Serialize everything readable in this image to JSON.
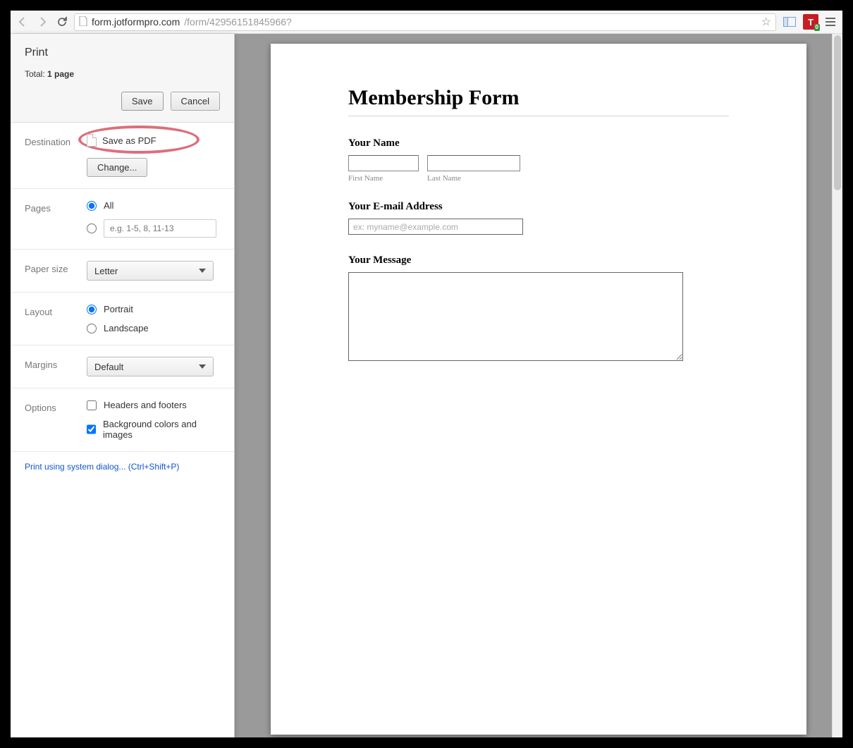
{
  "browser": {
    "url_host": "form.jotformpro.com",
    "url_path": "/form/42956151845966?",
    "ext_letter": "T",
    "ext_count": "0"
  },
  "print_panel": {
    "title": "Print",
    "total_prefix": "Total: ",
    "total_pages": "1 page",
    "save_btn": "Save",
    "cancel_btn": "Cancel",
    "destination_label": "Destination",
    "destination_value": "Save as PDF",
    "change_btn": "Change...",
    "pages_label": "Pages",
    "pages_all": "All",
    "pages_custom_placeholder": "e.g. 1-5, 8, 11-13",
    "paper_label": "Paper size",
    "paper_value": "Letter",
    "layout_label": "Layout",
    "layout_portrait": "Portrait",
    "layout_landscape": "Landscape",
    "margins_label": "Margins",
    "margins_value": "Default",
    "options_label": "Options",
    "opt_headers": "Headers and footers",
    "opt_bg": "Background colors and images",
    "system_link": "Print using system dialog... (Ctrl+Shift+P)"
  },
  "form": {
    "title": "Membership Form",
    "name_label": "Your Name",
    "first_name_sub": "First Name",
    "last_name_sub": "Last Name",
    "email_label": "Your E-mail Address",
    "email_placeholder": "ex: myname@example.com",
    "message_label": "Your Message"
  }
}
